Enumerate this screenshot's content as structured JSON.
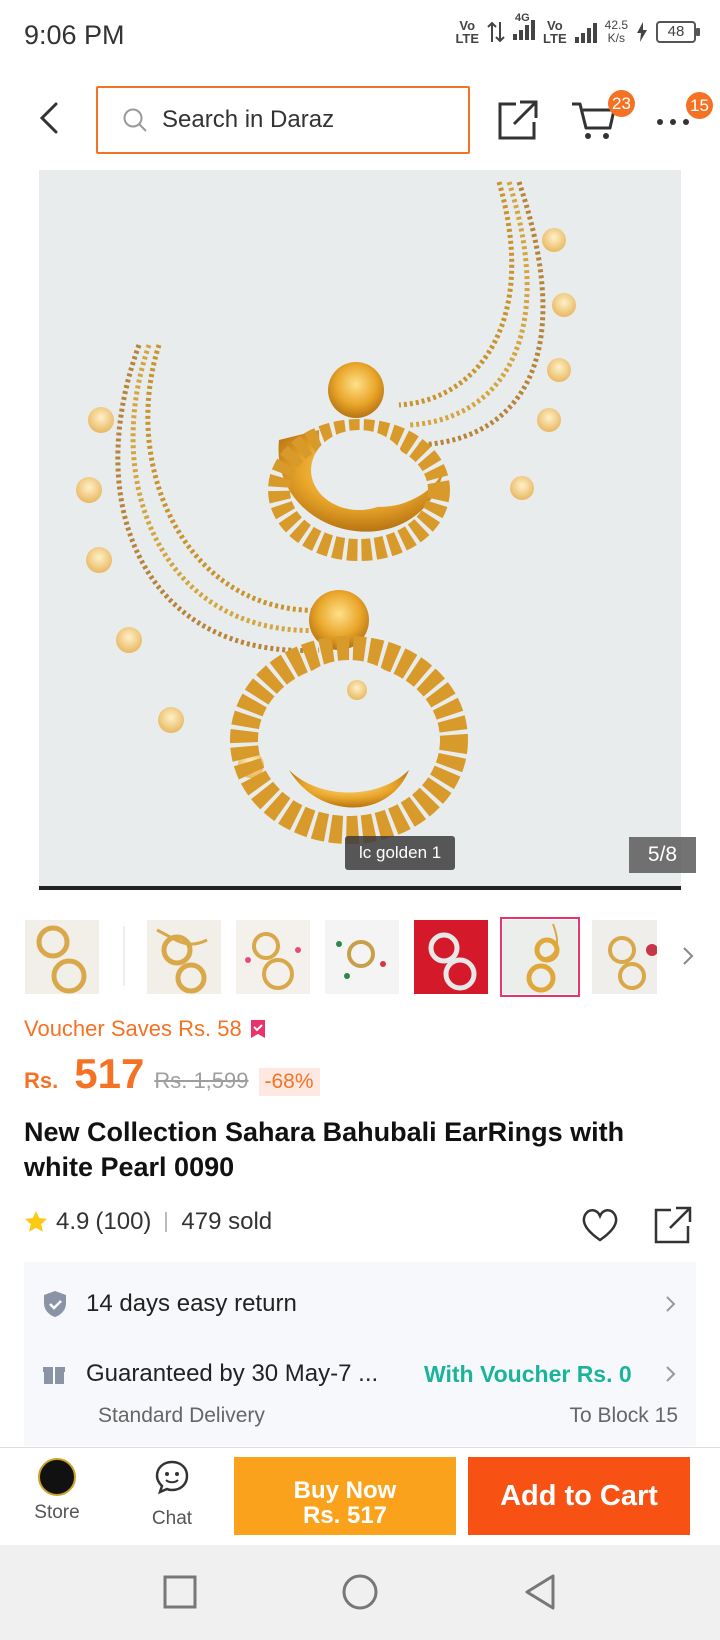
{
  "status_bar": {
    "time": "9:06 PM",
    "net1": "Vo\nLTE",
    "net2": "4G",
    "net3": "Vo\nLTE",
    "speed_value": "42.5",
    "speed_unit": "K/s",
    "battery": "48"
  },
  "header": {
    "search_placeholder": "Search in Daraz",
    "cart_count": "23",
    "more_count": "15"
  },
  "gallery": {
    "caption": "lc golden 1",
    "counter": "5/8",
    "thumbnail_count": 7,
    "selected_index": 5
  },
  "product": {
    "voucher_text": "Voucher Saves Rs. 58",
    "currency": "Rs.",
    "price": "517",
    "original_price": "Rs. 1,599",
    "discount": "-68%",
    "title": "New Collection Sahara Bahubali EarRings with white Pearl 0090",
    "rating": "4.9",
    "rating_count": "(100)",
    "sold": "479 sold"
  },
  "service": {
    "return_text": "14 days easy return",
    "delivery_text": "Guaranteed by 30 May-7 ...",
    "voucher_link": "With Voucher Rs. 0",
    "delivery_type": "Standard Delivery",
    "location": "To Block 15"
  },
  "bottom_bar": {
    "store_label": "Store",
    "chat_label": "Chat",
    "buy_now_line1": "Buy Now",
    "buy_now_line2": "Rs. 517",
    "add_to_cart": "Add to Cart"
  },
  "colors": {
    "accent": "#f57224",
    "buy_now": "#faa21c",
    "add_to_cart": "#f75113",
    "voucher_link": "#1bb39a"
  }
}
